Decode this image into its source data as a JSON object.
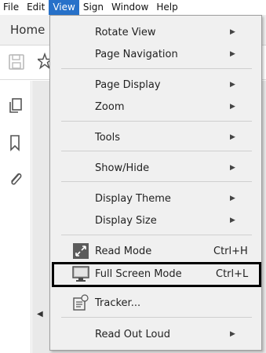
{
  "menubar": {
    "items": [
      "File",
      "Edit",
      "View",
      "Sign",
      "Window",
      "Help"
    ],
    "active": "View",
    "active_color": "#2771c9"
  },
  "tabs": {
    "home": "Home"
  },
  "view_menu": {
    "items": [
      {
        "label": "Rotate View",
        "submenu": true
      },
      {
        "label": "Page Navigation",
        "submenu": true
      },
      {
        "label": "Page Display",
        "submenu": true
      },
      {
        "label": "Zoom",
        "submenu": true
      },
      {
        "label": "Tools",
        "submenu": true
      },
      {
        "label": "Show/Hide",
        "submenu": true
      },
      {
        "label": "Display Theme",
        "submenu": true
      },
      {
        "label": "Display Size",
        "submenu": true
      },
      {
        "label": "Read Mode",
        "shortcut": "Ctrl+H",
        "icon": "read-mode-icon"
      },
      {
        "label": "Full Screen Mode",
        "shortcut": "Ctrl+L",
        "icon": "full-screen-icon"
      },
      {
        "label": "Tracker...",
        "icon": "tracker-icon"
      },
      {
        "label": "Read Out Loud",
        "submenu": true
      }
    ],
    "highlighted": "Full Screen Mode",
    "highlight_color": "#000000"
  },
  "icons": {
    "save": "save-icon",
    "star": "star-icon",
    "pages": "pages-icon",
    "bookmark": "bookmark-icon",
    "attachment": "paperclip-icon",
    "submenu": "chevron-right-icon"
  }
}
